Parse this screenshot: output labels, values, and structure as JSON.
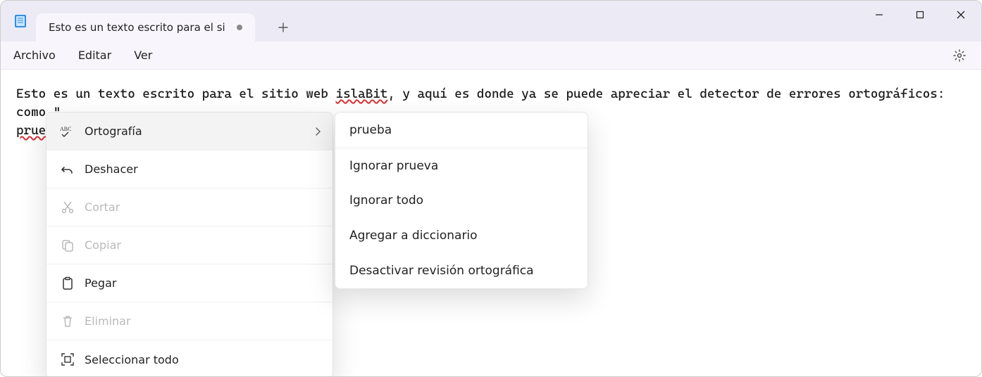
{
  "tab": {
    "title": "Esto es un texto escrito para el si"
  },
  "menubar": {
    "file": "Archivo",
    "edit": "Editar",
    "view": "Ver"
  },
  "editor": {
    "pre1": "Esto es un texto escrito para el sitio web ",
    "mis1": "islaBit",
    "mid1": ", y aquí es donde ya se puede apreciar el detector de errores ortográficos: como \" ",
    "mis2": "prueva",
    "post1": " \"."
  },
  "ctx": {
    "spelling": "Ortografía",
    "undo": "Deshacer",
    "cut": "Cortar",
    "copy": "Copiar",
    "paste": "Pegar",
    "delete": "Eliminar",
    "select_all": "Seleccionar todo"
  },
  "submenu": {
    "suggestion": "prueba",
    "ignore_once": "Ignorar prueva",
    "ignore_all": "Ignorar todo",
    "add_dict": "Agregar a diccionario",
    "disable": "Desactivar revisión ortográfica"
  }
}
